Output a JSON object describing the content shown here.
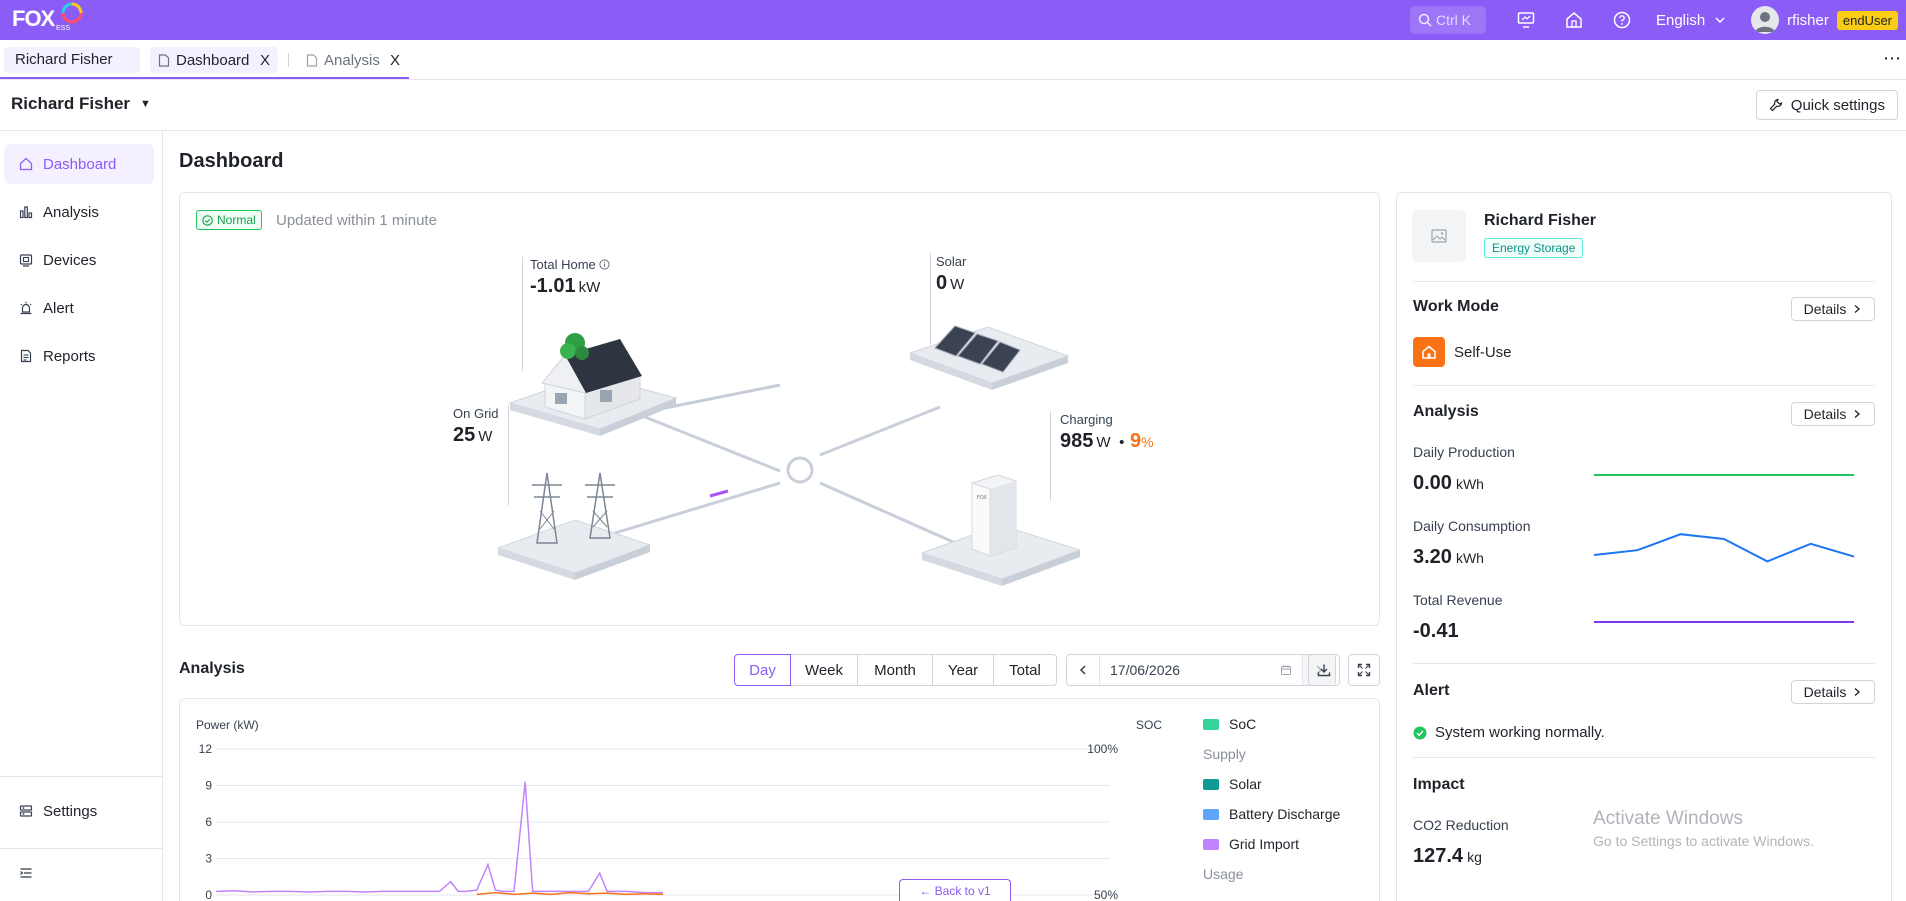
{
  "brand": {
    "logo_text": "FOX",
    "logo_sub": "ESS",
    "primary": "#8b5cf6"
  },
  "topbar": {
    "search_placeholder": "Ctrl K",
    "language": "English",
    "username": "rfisher",
    "role": "endUser",
    "icons": [
      "search-icon",
      "monitor-icon",
      "home-icon",
      "help-icon",
      "chevron-down-icon",
      "avatar"
    ]
  },
  "tabs": {
    "user_tab": "Richard Fisher",
    "items": [
      {
        "label": "Dashboard",
        "close": "X"
      },
      {
        "label": "Analysis",
        "close": "X"
      }
    ],
    "more": "⋯"
  },
  "header": {
    "account": "Richard Fisher",
    "quick_settings": "Quick settings"
  },
  "sidebar": {
    "items": [
      {
        "label": "Dashboard",
        "icon": "home-icon"
      },
      {
        "label": "Analysis",
        "icon": "bar-chart-icon"
      },
      {
        "label": "Devices",
        "icon": "device-icon"
      },
      {
        "label": "Alert",
        "icon": "alarm-icon"
      },
      {
        "label": "Reports",
        "icon": "report-icon"
      }
    ],
    "settings": "Settings"
  },
  "main": {
    "title": "Dashboard",
    "status": "Normal",
    "updated": "Updated within 1 minute",
    "flow": {
      "home": {
        "label": "Total Home",
        "value": "-1.01",
        "unit": "kW"
      },
      "solar": {
        "label": "Solar",
        "value": "0",
        "unit": "W"
      },
      "grid": {
        "label": "On Grid",
        "value": "25",
        "unit": "W"
      },
      "battery": {
        "label": "Charging",
        "value": "985",
        "unit": "W",
        "sep": "•",
        "soc": "9",
        "soc_unit": "%"
      }
    }
  },
  "analysis": {
    "title": "Analysis",
    "periods": [
      "Day",
      "Week",
      "Month",
      "Year",
      "Total"
    ],
    "active_period": "Day",
    "date": "17/06/2026",
    "back_v1": "← Back to v1"
  },
  "chart_data": {
    "type": "line",
    "ylabel": "Power (kW)",
    "y2label": "SOC",
    "ylim": [
      0,
      12
    ],
    "yticks": [
      "12",
      "9",
      "6",
      "3",
      "0"
    ],
    "y2ticks": [
      "100%",
      "50%"
    ],
    "grid": true,
    "legend_position": "right",
    "legend": {
      "soc": "SoC",
      "supply_heading": "Supply",
      "supply": [
        "Solar",
        "Battery Discharge",
        "Grid Import"
      ],
      "usage_heading": "Usage"
    },
    "series": [
      {
        "name": "Grid Import",
        "color": "#c084fc",
        "x": [
          0,
          0.5,
          1,
          1.5,
          2,
          2.5,
          3,
          3.5,
          4,
          4.5,
          5,
          5.5,
          6,
          6.3,
          6.5,
          6.7,
          7,
          7.3,
          7.5,
          7.7,
          8,
          8.3,
          8.5,
          8.7,
          9,
          9.5,
          10,
          10.3,
          10.5,
          10.7,
          11,
          11.5,
          12
        ],
        "values": [
          0.3,
          0.35,
          0.25,
          0.3,
          0.3,
          0.25,
          0.3,
          0.3,
          0.25,
          0.3,
          0.3,
          0.3,
          0.3,
          1.1,
          0.3,
          0.3,
          0.4,
          2.5,
          0.4,
          0.3,
          0.3,
          9.3,
          0.3,
          0.3,
          0.3,
          0.3,
          0.3,
          1.8,
          0.3,
          0.3,
          0.3,
          0.2,
          0.2
        ]
      },
      {
        "name": "Solar",
        "color": "#f97316",
        "x": [
          7,
          7.5,
          8,
          8.5,
          9,
          9.5,
          10,
          10.5,
          11,
          11.5,
          12
        ],
        "values": [
          0.05,
          0.2,
          0.05,
          0.15,
          0.05,
          0.2,
          0.1,
          0.15,
          0.05,
          0.1,
          0.05
        ]
      }
    ],
    "xlim": [
      0,
      24
    ]
  },
  "right": {
    "site_name": "Richard Fisher",
    "site_type": "Energy Storage",
    "work_mode": {
      "title": "Work Mode",
      "details": "Details",
      "mode": "Self-Use"
    },
    "analysis": {
      "title": "Analysis",
      "details": "Details",
      "production": {
        "label": "Daily Production",
        "value": "0.00",
        "unit": "kWh",
        "color": "#22c55e",
        "trend": [
          0.5,
          0.5,
          0.5,
          0.5,
          0.5,
          0.5,
          0.5
        ]
      },
      "consumption": {
        "label": "Daily Consumption",
        "value": "3.20",
        "unit": "kWh",
        "color": "#1d74f5",
        "trend": [
          0.25,
          0.4,
          0.9,
          0.75,
          0.05,
          0.6,
          0.2
        ]
      },
      "revenue": {
        "label": "Total Revenue",
        "value": "-0.41",
        "color": "#7c3aed",
        "trend": [
          0.5,
          0.5,
          0.5,
          0.5,
          0.5,
          0.5,
          0.5
        ]
      }
    },
    "alert": {
      "title": "Alert",
      "details": "Details",
      "text": "System working normally."
    },
    "impact": {
      "title": "Impact",
      "co2_label": "CO2 Reduction",
      "co2_value": "127.4",
      "co2_unit": "kg"
    }
  },
  "overlay": {
    "line1": "Activate Windows",
    "line2": "Go to Settings to activate Windows."
  }
}
